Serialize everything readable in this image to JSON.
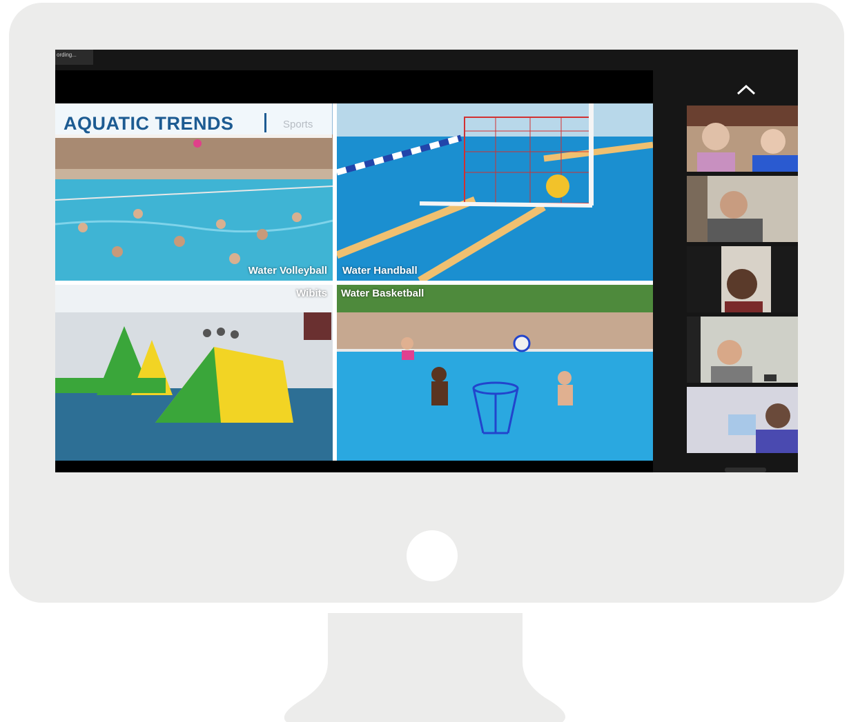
{
  "recording": {
    "label": "ording..."
  },
  "slide": {
    "title": "AQUATIC TRENDS",
    "subtitle": "Sports",
    "panels": [
      {
        "label": "Water Volleyball"
      },
      {
        "label": "Water Handball"
      },
      {
        "label": "Wibits"
      },
      {
        "label": "Water Basketball"
      }
    ]
  },
  "sidebar": {
    "collapse_icon": "chevron-up-icon",
    "participant_count": 5
  },
  "colors": {
    "bezel": "#ececeb",
    "screen_bg": "#161616",
    "title_blue": "#1d5b92",
    "pool_blue": "#2a9fd6"
  }
}
